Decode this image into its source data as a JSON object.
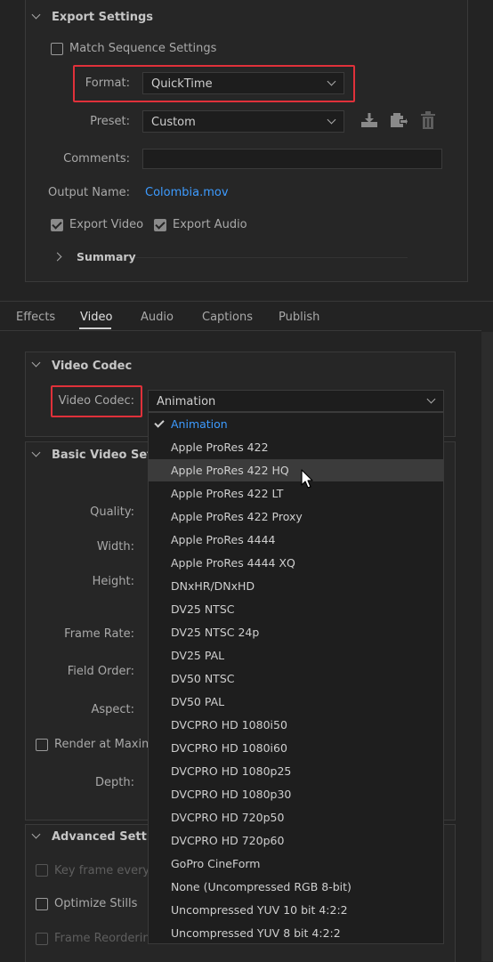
{
  "export_settings": {
    "title": "Export Settings",
    "match_sequence_label": "Match Sequence Settings",
    "format_label": "Format:",
    "format_value": "QuickTime",
    "preset_label": "Preset:",
    "preset_value": "Custom",
    "comments_label": "Comments:",
    "comments_value": "",
    "output_name_label": "Output Name:",
    "output_name_value": "Colombia.mov",
    "export_video_label": "Export Video",
    "export_audio_label": "Export Audio",
    "summary_label": "Summary",
    "link_color": "#3d9bff",
    "highlight_color": "#e0313a"
  },
  "tabs": [
    {
      "label": "Effects"
    },
    {
      "label": "Video"
    },
    {
      "label": "Audio"
    },
    {
      "label": "Captions"
    },
    {
      "label": "Publish"
    }
  ],
  "active_tab": "Video",
  "video_codec": {
    "title": "Video Codec",
    "label": "Video Codec:",
    "value": "Animation"
  },
  "basic_video": {
    "title": "Basic Video Settin",
    "quality_label": "Quality:",
    "width_label": "Width:",
    "height_label": "Height:",
    "frame_rate_label": "Frame Rate:",
    "field_order_label": "Field Order:",
    "aspect_label": "Aspect:",
    "render_max_label": "Render at Maximu",
    "depth_label": "Depth:"
  },
  "advanced": {
    "title": "Advanced Setting",
    "key_frame_label": "Key frame every",
    "optimize_stills_label": "Optimize Stills",
    "frame_reordering_label": "Frame Reordering"
  },
  "codec_menu": {
    "items": [
      "Animation",
      "Apple ProRes 422",
      "Apple ProRes 422 HQ",
      "Apple ProRes 422 LT",
      "Apple ProRes 422 Proxy",
      "Apple ProRes 4444",
      "Apple ProRes 4444 XQ",
      "DNxHR/DNxHD",
      "DV25 NTSC",
      "DV25 NTSC 24p",
      "DV25 PAL",
      "DV50 NTSC",
      "DV50 PAL",
      "DVCPRO HD 1080i50",
      "DVCPRO HD 1080i60",
      "DVCPRO HD 1080p25",
      "DVCPRO HD 1080p30",
      "DVCPRO HD 720p50",
      "DVCPRO HD 720p60",
      "GoPro CineForm",
      "None (Uncompressed RGB 8-bit)",
      "Uncompressed YUV 10 bit 4:2:2",
      "Uncompressed YUV 8 bit 4:2:2"
    ],
    "selected": "Animation",
    "hovered": "Apple ProRes 422 HQ"
  }
}
